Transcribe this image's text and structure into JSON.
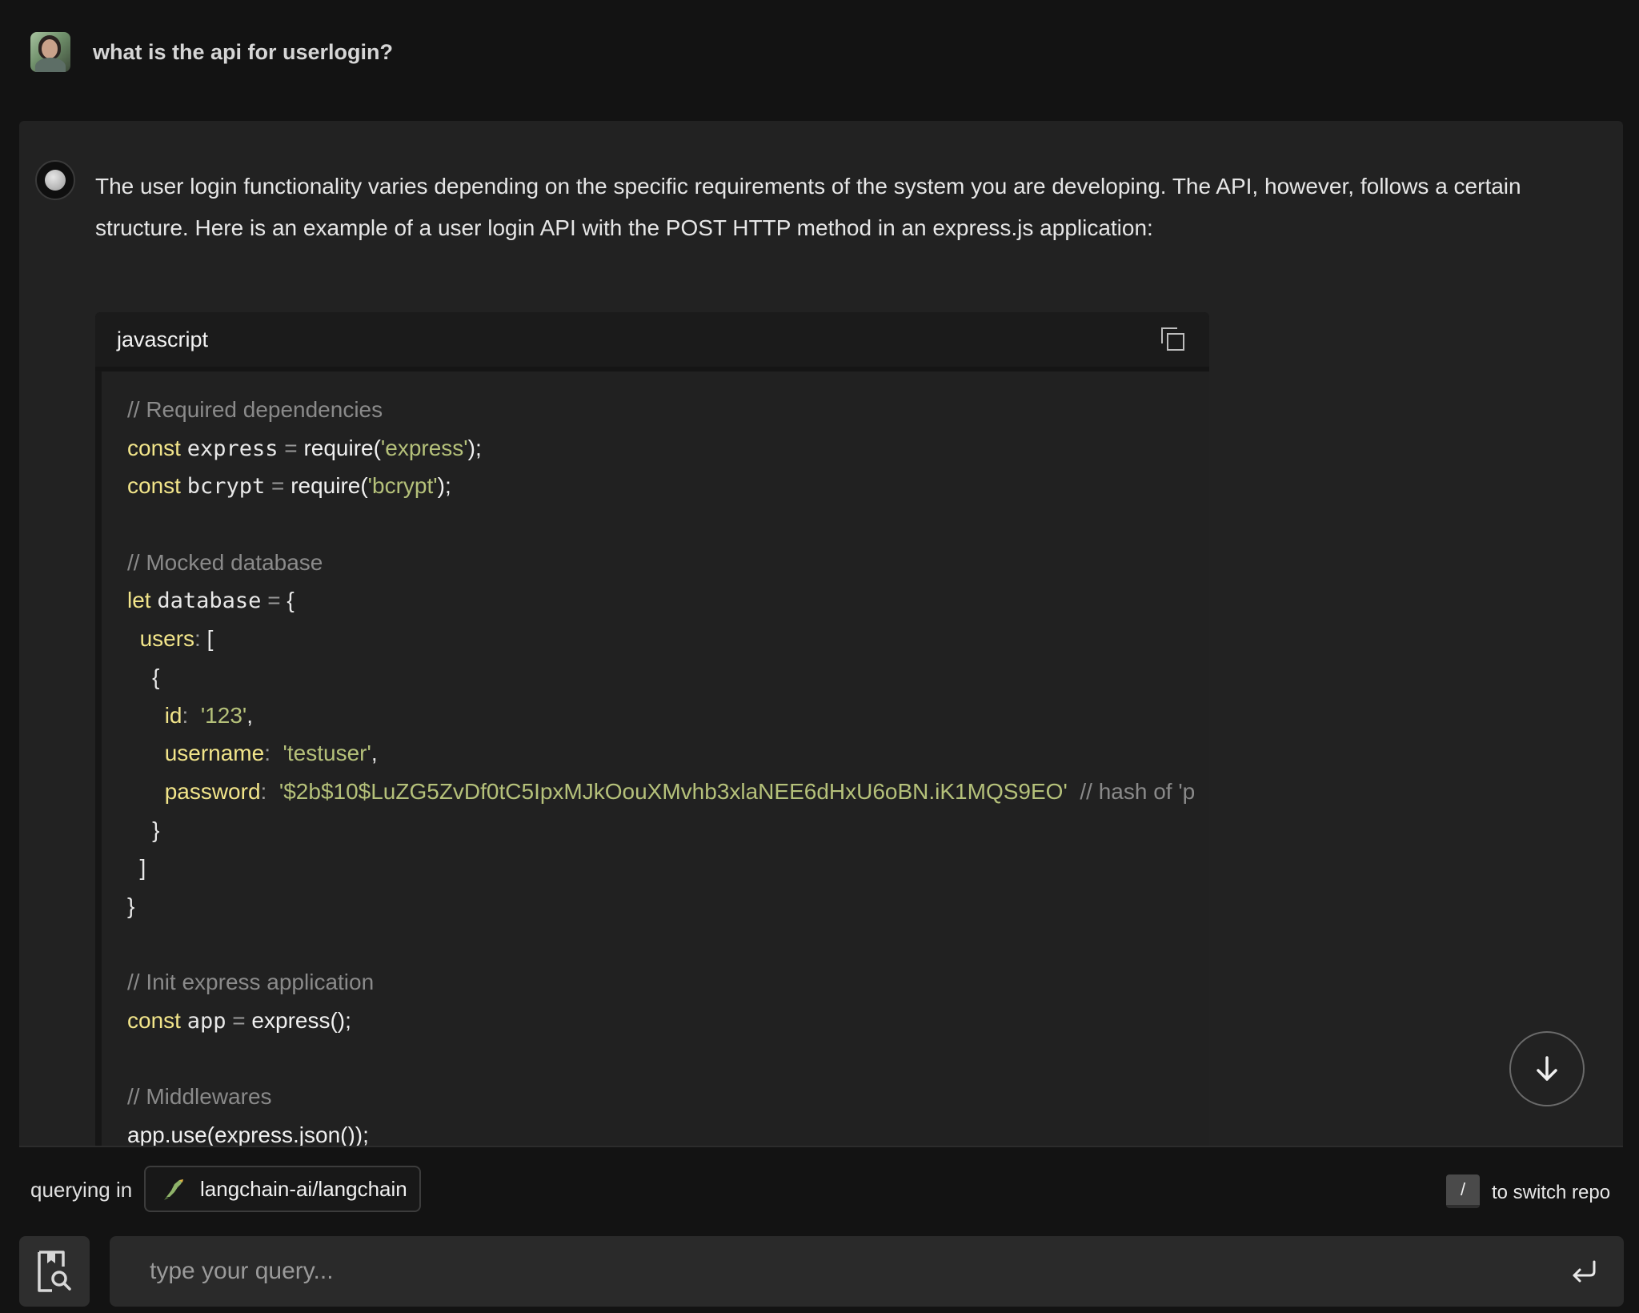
{
  "conversation": {
    "user_question": "what is the api for userlogin?",
    "answer_text": "The user login functionality varies depending on the specific requirements of the system you are developing. The API, however, follows a certain structure. Here is an example of a user login API with the POST HTTP method in an express.js application:"
  },
  "code": {
    "language": "javascript",
    "lines": [
      "// Required dependencies",
      "const express = require('express');",
      "const bcrypt = require('bcrypt');",
      "",
      "// Mocked database",
      "let database = {",
      "  users: [",
      "    {",
      "      id: '123',",
      "      username: 'testuser',",
      "      password: '$2b$10$LuZG5ZvDf0tC5IpxMJkOouXMvhb3xlaNEE6dHxU6oBN.iK1MQS9EO' // hash of 'p",
      "    }",
      "  ]",
      "}",
      "",
      "// Init express application",
      "const app = express();",
      "",
      "// Middlewares",
      "app.use(express.json());"
    ]
  },
  "footer": {
    "querying_label": "querying in",
    "repo": "langchain-ai/langchain",
    "slash_key": "/",
    "switch_label": "to switch repo",
    "query_placeholder": "type your query..."
  }
}
